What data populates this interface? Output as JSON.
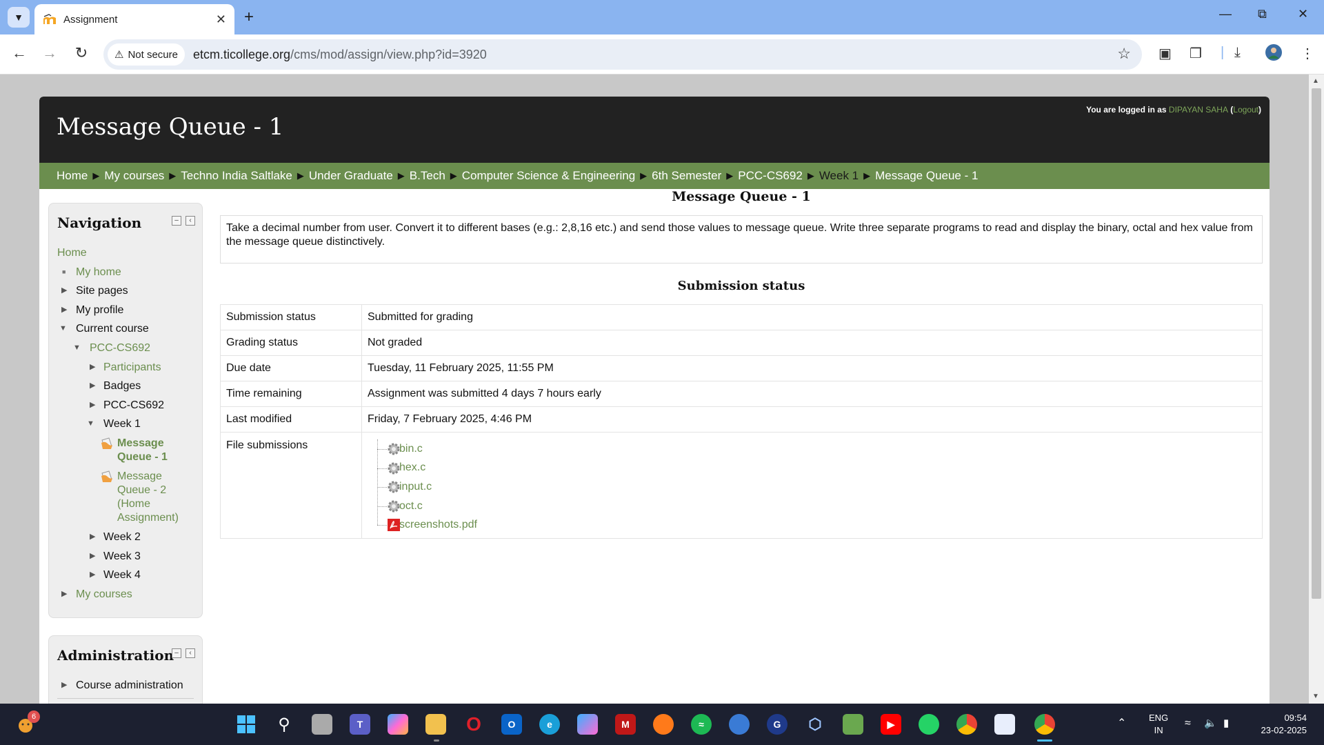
{
  "browser": {
    "tab_title": "Assignment",
    "security_label": "Not secure",
    "url_host": "etcm.ticollege.org",
    "url_path": "/cms/mod/assign/view.php?id=3920"
  },
  "header": {
    "title": "Message Queue - 1",
    "login_prefix": "You are logged in as",
    "user_name": "DIPAYAN SAHA",
    "logout_label": "Logout"
  },
  "breadcrumb": [
    "Home",
    "My courses",
    "Techno India Saltlake",
    "Under Graduate",
    "B.Tech",
    "Computer Science & Engineering",
    "6th Semester",
    "PCC-CS692",
    "Week 1",
    "Message Queue - 1"
  ],
  "navigation": {
    "title": "Navigation",
    "items": {
      "home": "Home",
      "my_home": "My home",
      "site_pages": "Site pages",
      "my_profile": "My profile",
      "current_course": "Current course",
      "course": "PCC-CS692",
      "participants": "Participants",
      "badges": "Badges",
      "section": "PCC-CS692",
      "week1": "Week 1",
      "mq1": "Message Queue - 1",
      "mq2": "Message Queue - 2 (Home Assignment)",
      "week2": "Week 2",
      "week3": "Week 3",
      "week4": "Week 4",
      "my_courses": "My courses"
    }
  },
  "administration": {
    "title": "Administration",
    "course_admin": "Course administration"
  },
  "main": {
    "heading": "Message Queue - 1",
    "description": "Take a decimal number from user. Convert it to different bases (e.g.: 2,8,16 etc.) and send those values to message queue. Write three separate programs to read and display the binary, octal and hex value from the message queue distinctively.",
    "submission_heading": "Submission status",
    "rows": [
      {
        "label": "Submission status",
        "value": "Submitted for grading"
      },
      {
        "label": "Grading status",
        "value": "Not graded"
      },
      {
        "label": "Due date",
        "value": "Tuesday, 11 February 2025, 11:55 PM"
      },
      {
        "label": "Time remaining",
        "value": "Assignment was submitted 4 days 7 hours early"
      },
      {
        "label": "Last modified",
        "value": "Friday, 7 February 2025, 4:46 PM"
      }
    ],
    "files_label": "File submissions",
    "files": [
      "bin.c",
      "hex.c",
      "input.c",
      "oct.c",
      "screenshots.pdf"
    ]
  },
  "taskbar": {
    "weather_badge": "6",
    "lang_top": "ENG",
    "lang_bottom": "IN",
    "time": "09:54",
    "date": "23-02-2025"
  },
  "colors": {
    "accent_green": "#6b8e4e",
    "header_dark": "#222222",
    "chrome_blue": "#8ab4f0"
  }
}
